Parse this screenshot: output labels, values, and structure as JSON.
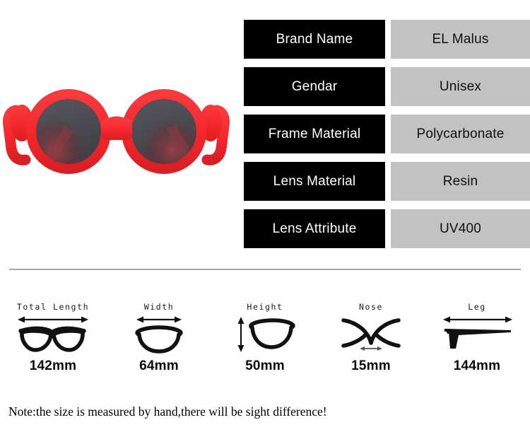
{
  "product": {
    "image_name": "round-sunglasses-photo",
    "frame_color": "#f5262b",
    "frame_shadow_color": "#c41a20",
    "lens_color": "#4b4b52",
    "lens_highlight_color": "#7a3a3f",
    "lens_reflection_color": "#8e3b40"
  },
  "spec_table": {
    "label_bg": "#000000",
    "value_bg": "#c2c2c2",
    "rows": [
      {
        "label": "Brand Name",
        "value": "EL Malus"
      },
      {
        "label": "Gendar",
        "value": "Unisex"
      },
      {
        "label": "Frame Material",
        "value": "Polycarbonate"
      },
      {
        "label": "Lens Material",
        "value": "Resin"
      },
      {
        "label": "Lens Attribute",
        "value": "UV400"
      }
    ]
  },
  "divider": {
    "color": "#a8a8a8"
  },
  "dimensions": {
    "items": [
      {
        "title": "Total Length",
        "value": "142mm",
        "icon": "full-frame-horizontal-arrow-icon"
      },
      {
        "title": "Width",
        "value": "64mm",
        "icon": "single-lens-horizontal-arrow-icon"
      },
      {
        "title": "Height",
        "value": "50mm",
        "icon": "single-lens-vertical-arrow-icon"
      },
      {
        "title": "Nose",
        "value": "15mm",
        "icon": "nose-bridge-icon"
      },
      {
        "title": "Leg",
        "value": "144mm",
        "icon": "temple-arm-icon"
      }
    ]
  },
  "footer": {
    "note": "Note:the size is measured by hand,there will be sight difference!"
  }
}
